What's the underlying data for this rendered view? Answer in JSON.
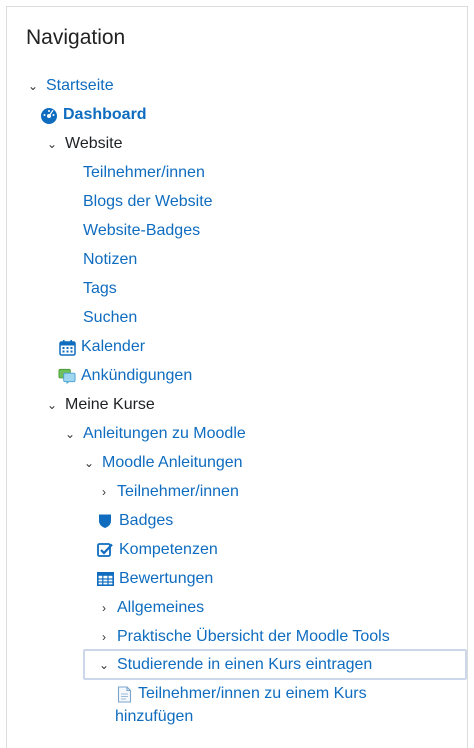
{
  "block": {
    "title": "Navigation"
  },
  "tree": {
    "startseite": "Startseite",
    "dashboard": "Dashboard",
    "website": "Website",
    "website_items": [
      "Teilnehmer/innen",
      "Blogs der Website",
      "Website-Badges",
      "Notizen",
      "Tags",
      "Suchen"
    ],
    "kalender": "Kalender",
    "ankuendigungen": "Ankündigungen",
    "meine_kurse": "Meine Kurse",
    "course": "Anleitungen zu Moodle",
    "section": "Moodle Anleitungen",
    "section_items": {
      "teilnehmer": "Teilnehmer/innen",
      "badges": "Badges",
      "kompetenzen": "Kompetenzen",
      "bewertungen": "Bewertungen",
      "allgemeines": "Allgemeines",
      "praktische": "Praktische Übersicht der Moodle Tools",
      "studierende": "Studierende in einen Kurs eintragen"
    },
    "activity_line1": "Teilnehmer/innen zu einem Kurs",
    "activity_line2": "hinzufügen"
  },
  "icons": {
    "dashboard": "dashboard-gauge-icon",
    "calendar": "calendar-icon",
    "announcements": "forum-icon",
    "badges": "shield-icon",
    "competencies": "checkbox-icon",
    "grades": "table-icon",
    "page": "page-icon"
  },
  "colors": {
    "link": "#0f6cbf",
    "selection_border": "#cdd7ea"
  }
}
